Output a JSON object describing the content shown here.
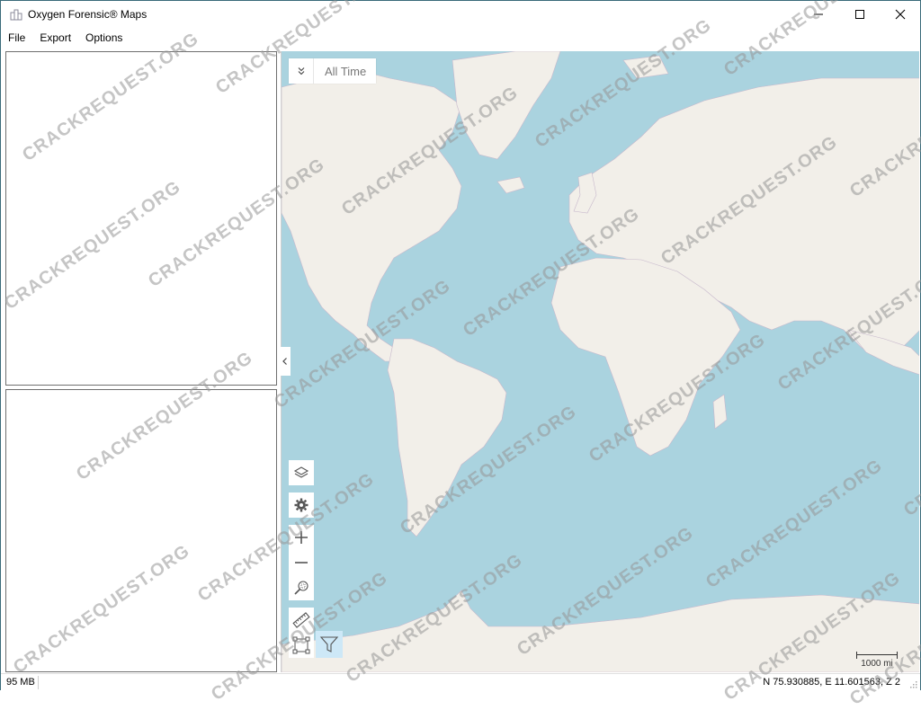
{
  "window": {
    "title": "Oxygen Forensic® Maps",
    "icon": "app-maps-icon",
    "controls": {
      "minimize": "minimize-icon",
      "maximize": "maximize-icon",
      "close": "close-icon"
    }
  },
  "menu": {
    "items": [
      {
        "label": "File"
      },
      {
        "label": "Export"
      },
      {
        "label": "Options"
      }
    ]
  },
  "map": {
    "time_filter": {
      "toggle_icon": "double-chevron-down-icon",
      "label": "All Time"
    },
    "collapse_icon": "chevron-left-icon",
    "tools": [
      {
        "name": "layers",
        "icon": "layers-icon"
      },
      {
        "name": "settings",
        "icon": "gear-icon"
      },
      {
        "name": "zoom-in",
        "icon": "plus-icon"
      },
      {
        "name": "zoom-out",
        "icon": "minus-icon"
      },
      {
        "name": "zoom-to-fit",
        "icon": "zoom-extent-icon"
      },
      {
        "name": "measure",
        "icon": "ruler-icon"
      },
      {
        "name": "select-area",
        "icon": "selection-rectangle-icon"
      },
      {
        "name": "filter",
        "icon": "filter-icon",
        "active": true
      }
    ],
    "scale_label": "1000 mi",
    "colors": {
      "water": "#aad3df",
      "land": "#f2efe9",
      "border": "#b9a6c0",
      "active_tool": "#cde8f7"
    }
  },
  "status": {
    "memory": "95 MB",
    "coordinates": "N 75.930885, E 11.601563, Z 2"
  },
  "watermark": "CRACKREQUEST.ORG"
}
